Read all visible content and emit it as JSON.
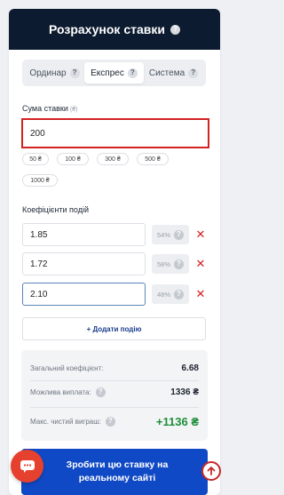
{
  "header": {
    "title": "Розрахунок ставки"
  },
  "tabs": [
    {
      "label": "Ординар",
      "active": false
    },
    {
      "label": "Експрес",
      "active": true
    },
    {
      "label": "Система",
      "active": false
    }
  ],
  "stake": {
    "label": "Сума ставки",
    "currency": "(₴)",
    "value": "200",
    "chips": [
      "50 ₴",
      "100 ₴",
      "300 ₴",
      "500 ₴",
      "1000 ₴"
    ]
  },
  "odds": {
    "label": "Коефіцієнти подій",
    "rows": [
      {
        "value": "1.85",
        "probability": "54%"
      },
      {
        "value": "1.72",
        "probability": "58%"
      },
      {
        "value": "2.10",
        "probability": "48%"
      }
    ],
    "add_label": "+ Додати подію"
  },
  "summary": {
    "total_coef_label": "Загальний коефіцієнт:",
    "total_coef_value": "6.68",
    "payout_label": "Можлива виплата:",
    "payout_value": "1336 ₴",
    "profit_label": "Макс. чистий виграш:",
    "profit_value": "+1136 ₴"
  },
  "cta": {
    "label": "Зробити цю ставку на реальному сайті"
  },
  "colors": {
    "header_bg": "#0d1b30",
    "accent_blue": "#1049c6",
    "error_red": "#d42121",
    "profit_green": "#1f8f3a",
    "chat_red": "#e5412e"
  },
  "icons": {
    "help": "question-circle-icon",
    "remove": "close-icon",
    "chat": "chat-icon",
    "scroll_top": "arrow-up-icon"
  }
}
